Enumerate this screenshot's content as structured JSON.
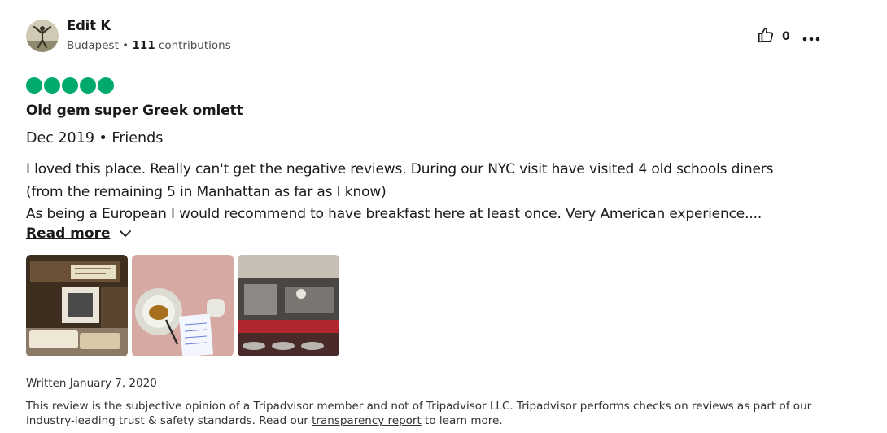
{
  "author": {
    "name": "Edit K",
    "location": "Budapest",
    "separator": " • ",
    "contributions_count": "111",
    "contributions_label": " contributions"
  },
  "helpful": {
    "count": "0",
    "icon": "thumbs-up-icon"
  },
  "more_menu": {
    "icon": "more-options-icon"
  },
  "rating": {
    "value": 5,
    "max": 5,
    "color": "#00aa6c"
  },
  "review": {
    "title": "Old gem super Greek omlett",
    "visit": "Dec 2019 • Friends",
    "body_lines": [
      "I loved this place. Really can't get the negative reviews. During our NYC visit have visited 4 old schools diners",
      "(from the remaining 5 in Manhattan as far as I know)",
      "As being a European I would recommend to have breakfast here at least once. Very American experience...."
    ],
    "read_more_label": "Read more"
  },
  "photos": [
    {
      "name": "photo-diner-counter"
    },
    {
      "name": "photo-coffee-cup"
    },
    {
      "name": "photo-diner-interior"
    }
  ],
  "written": "Written January 7, 2020",
  "disclaimer": {
    "text_before": "This review is the subjective opinion of a Tripadvisor member and not of Tripadvisor LLC. Tripadvisor performs checks on reviews as part of our industry-leading trust & safety standards. Read our ",
    "link": "transparency report",
    "text_after": " to learn more."
  },
  "colors": {
    "rating_green": "#00aa6c",
    "text": "#1a1a1a",
    "muted": "#4d4d4d"
  }
}
